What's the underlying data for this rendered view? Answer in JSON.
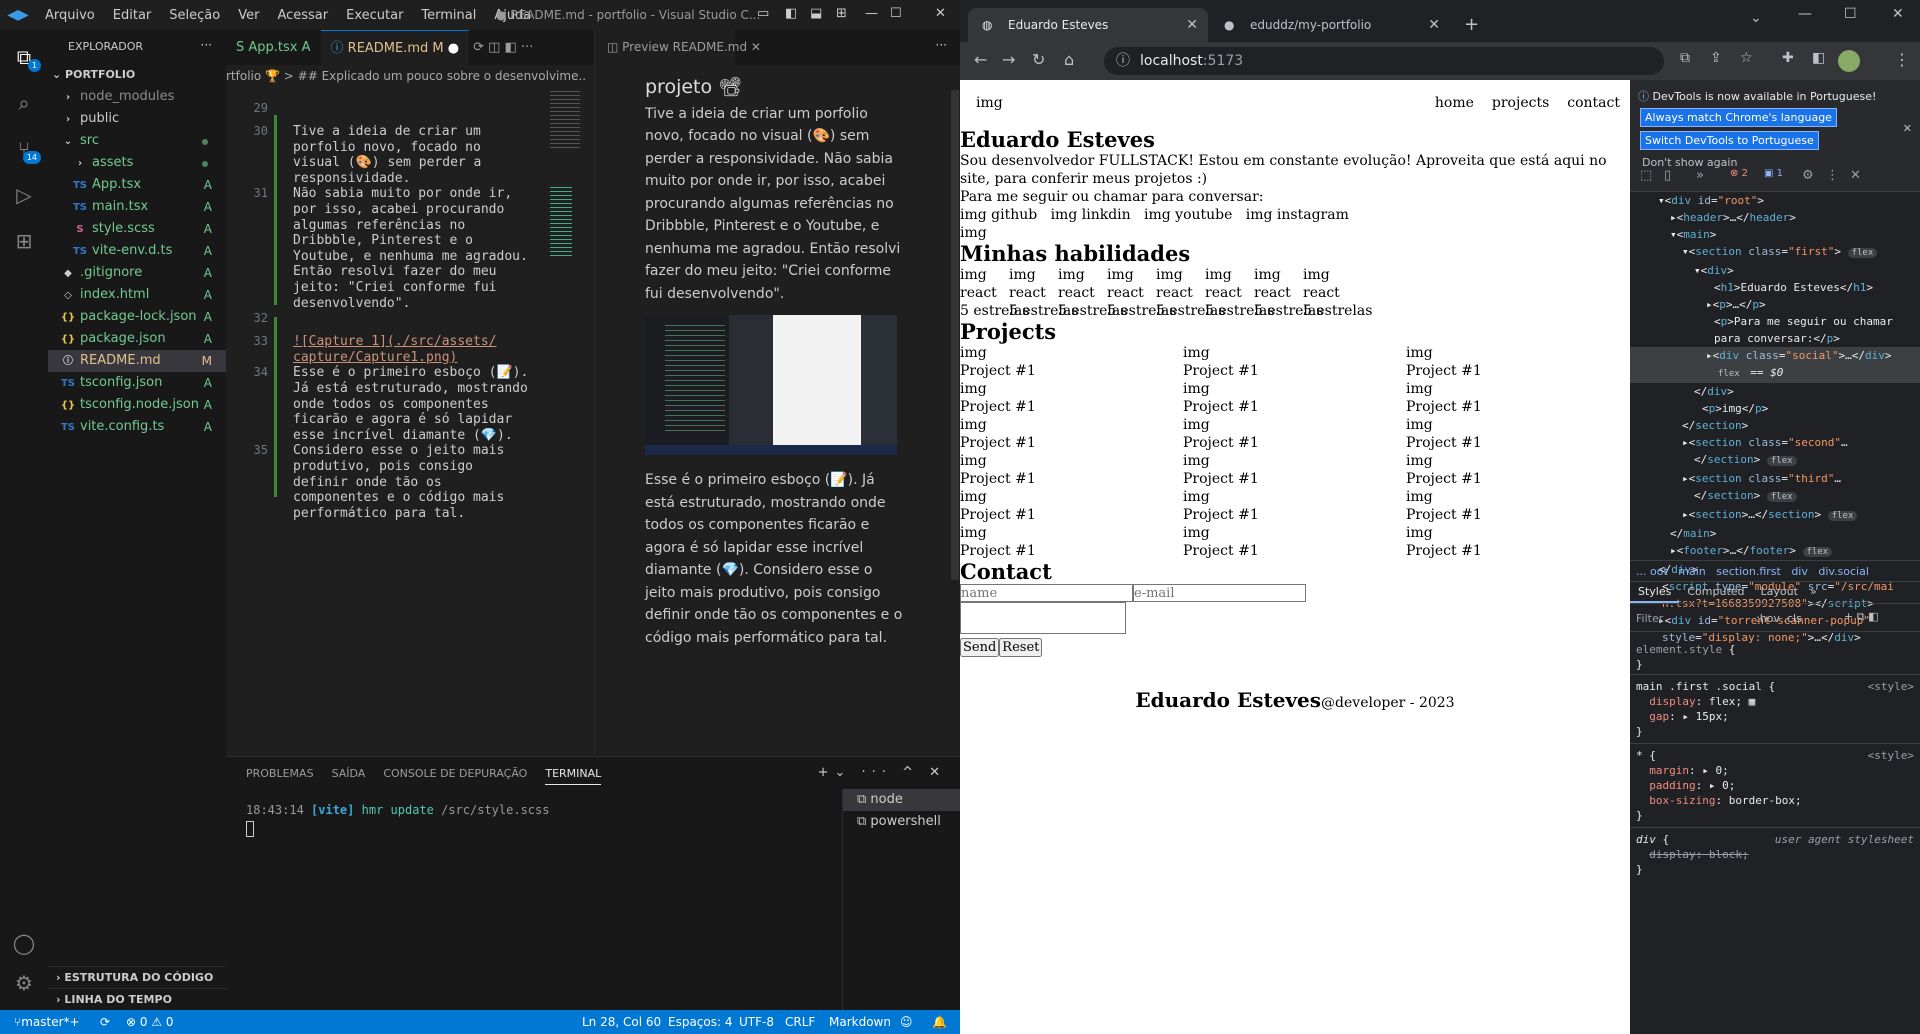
{
  "vscode": {
    "menu": [
      "Arquivo",
      "Editar",
      "Seleção",
      "Ver",
      "Acessar",
      "Executar",
      "Terminal",
      "Ajuda"
    ],
    "window_title": "● README.md - portfolio - Visual Studio C...",
    "explorer_header": "EXPLORADOR",
    "project": "PORTFOLIO",
    "tree": [
      {
        "label": "node_modules",
        "icon": "›",
        "indent": 1,
        "status": "",
        "color": "#8b8b8b"
      },
      {
        "label": "public",
        "icon": "›",
        "indent": 1,
        "status": "",
        "color": "#ccc"
      },
      {
        "label": "src",
        "icon": "⌄",
        "indent": 1,
        "status": "",
        "color": "#73c991"
      },
      {
        "label": "assets",
        "icon": "›",
        "indent": 2,
        "status": "",
        "color": "#73c991"
      },
      {
        "label": "App.tsx",
        "icon": "TS",
        "indent": 2,
        "status": "A",
        "color": "#73c991"
      },
      {
        "label": "main.tsx",
        "icon": "TS",
        "indent": 2,
        "status": "A",
        "color": "#73c991"
      },
      {
        "label": "style.scss",
        "icon": "S",
        "indent": 2,
        "status": "A",
        "color": "#73c991"
      },
      {
        "label": "vite-env.d.ts",
        "icon": "TS",
        "indent": 2,
        "status": "A",
        "color": "#73c991"
      },
      {
        "label": ".gitignore",
        "icon": "◆",
        "indent": 1,
        "status": "A",
        "color": "#73c991"
      },
      {
        "label": "index.html",
        "icon": "◇",
        "indent": 1,
        "status": "A",
        "color": "#73c991"
      },
      {
        "label": "package-lock.json",
        "icon": "{}",
        "indent": 1,
        "status": "A",
        "color": "#73c991"
      },
      {
        "label": "package.json",
        "icon": "{}",
        "indent": 1,
        "status": "A",
        "color": "#73c991"
      },
      {
        "label": "README.md",
        "icon": "ⓘ",
        "indent": 1,
        "status": "M",
        "color": "#e2c08d"
      },
      {
        "label": "tsconfig.json",
        "icon": "TS",
        "indent": 1,
        "status": "A",
        "color": "#73c991"
      },
      {
        "label": "tsconfig.node.json",
        "icon": "{}",
        "indent": 1,
        "status": "A",
        "color": "#73c991"
      },
      {
        "label": "vite.config.ts",
        "icon": "TS",
        "indent": 1,
        "status": "A",
        "color": "#73c991"
      }
    ],
    "outline": "ESTRUTURA DO CÓDIGO",
    "timeline": "LINHA DO TEMPO",
    "tabs": [
      "S App.tsx  A",
      "README.md  M"
    ],
    "breadcrumb": "rtfolio 🏆 > ## Explicado um pouco sobre o desenvolvime...",
    "lines": [
      {
        "n": "29",
        "text": ""
      },
      {
        "n": "30",
        "text": "Tive a ideia de criar um"
      },
      {
        "n": "",
        "text": "porfolio novo, focado no"
      },
      {
        "n": "",
        "text": "visual (🎨) sem perder a"
      },
      {
        "n": "",
        "text": "responsividade."
      },
      {
        "n": "31",
        "text": "Não sabia muito por onde ir,"
      },
      {
        "n": "",
        "text": "por isso, acabei procurando"
      },
      {
        "n": "",
        "text": "algumas referências no"
      },
      {
        "n": "",
        "text": "Dribbble, Pinterest e o"
      },
      {
        "n": "",
        "text": "Youtube, e nenhuma me agradou."
      },
      {
        "n": "",
        "text": "Então resolvi fazer do meu"
      },
      {
        "n": "",
        "text": "jeito: \"Criei conforme fui"
      },
      {
        "n": "",
        "text": "desenvolvendo\"."
      },
      {
        "n": "32",
        "text": ""
      },
      {
        "n": "33",
        "text": "![Capture 1](./src/assets/"
      },
      {
        "n": "",
        "text": "capture/Capture1.png)"
      },
      {
        "n": "34",
        "text": "Esse é o primeiro esboço (📝)."
      },
      {
        "n": "",
        "text": "Já está estruturado, mostrando"
      },
      {
        "n": "",
        "text": "onde todos os componentes"
      },
      {
        "n": "",
        "text": "ficarão e agora é só lapidar"
      },
      {
        "n": "",
        "text": "esse incrível diamante (💎)."
      },
      {
        "n": "35",
        "text": "Considero esse o jeito mais"
      },
      {
        "n": "",
        "text": "produtivo, pois consigo"
      },
      {
        "n": "",
        "text": "definir onde tão os"
      },
      {
        "n": "",
        "text": "componentes e o código mais"
      },
      {
        "n": "",
        "text": "performático para tal."
      }
    ],
    "preview_tab": "Preview README.md",
    "preview_heading": "projeto 📽",
    "preview_p1": "Tive a ideia de criar um porfolio novo, focado no visual (🎨) sem perder a responsividade. Não sabia muito por onde ir, por isso, acabei procurando algumas referências no Dribbble, Pinterest e o Youtube, e nenhuma me agradou. Então resolvi fazer do meu jeito: \"Criei conforme fui desenvolvendo\".",
    "preview_p2": "Esse é o primeiro esboço (📝). Já está estruturado, mostrando onde todos os componentes ficarão e agora é só lapidar esse incrível diamante (💎). Considero esse o jeito mais produtivo, pois consigo definir onde tão os componentes e o código mais performático para tal.",
    "panel_tabs": [
      "PROBLEMAS",
      "SAÍDA",
      "CONSOLE DE DEPURAÇÃO",
      "TERMINAL"
    ],
    "term_time": "18:43:14",
    "term_vite": "[vite]",
    "term_msg": "hmr update",
    "term_path": "/src/style.scss",
    "terminals": [
      "node",
      "powershell"
    ],
    "status_branch": "master*+",
    "status_errors": "⊗ 0 ⚠ 0",
    "status_pos": "Ln 28, Col 60",
    "status_spaces": "Espaços: 4",
    "status_enc": "UTF-8",
    "status_eol": "CRLF",
    "status_lang": "Markdown"
  },
  "chrome": {
    "tab1": "Eduardo Esteves",
    "tab2": "eduddz/my-portfolio",
    "url_host": "localhost",
    "url_port": ":5173"
  },
  "site": {
    "img": "img",
    "nav": [
      "home",
      "projects",
      "contact"
    ],
    "name": "Eduardo Esteves",
    "intro": "Sou desenvolvedor FULLSTACK! Estou em constante evolução! Aproveita que está aqui no site, para conferir meus projetos :)",
    "follow": "Para me seguir ou chamar para conversar:",
    "social": "img github   img linkdin   img youtube   img instagram",
    "skills_title": "Minhas habilidades",
    "skill_name": "react",
    "skill_stars": "5 estrelas",
    "projects_title": "Projects",
    "project_name": "Project #1",
    "contact_title": "Contact",
    "name_ph": "name",
    "email_ph": "e-mail",
    "send": "Send",
    "reset": "Reset",
    "footer_name": "Eduardo Esteves",
    "footer_rest": "@developer - 2023"
  },
  "devtools": {
    "notice": "DevTools is now available in Portuguese!",
    "btn1": "Always match Chrome's language",
    "btn2": "Switch DevTools to Portuguese",
    "dont": "Don't show again",
    "errors": "2",
    "msgs": "1",
    "crumbs": "... oot   main   section.first   div   div.social",
    "tabs": [
      "Styles",
      "Computed",
      "Layout"
    ],
    "filter": "Filter",
    "hov": ":hov .cls"
  }
}
